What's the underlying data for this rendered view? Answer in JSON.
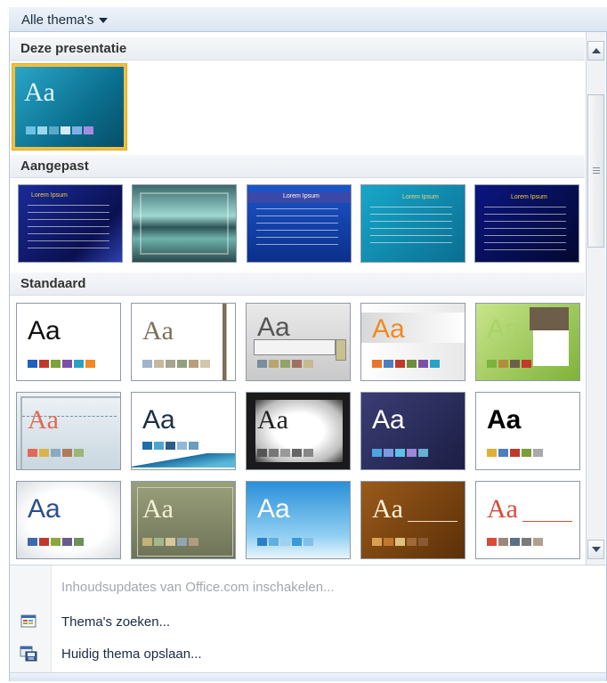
{
  "gallery": {
    "header_label": "Alle thema's",
    "sections": {
      "current": "Deze presentatie",
      "custom": "Aangepast",
      "standard": "Standaard"
    },
    "current_theme": {
      "sample": "Aa"
    },
    "custom_themes": [
      {
        "title": "Lorem Ipsum"
      },
      {
        "title": ""
      },
      {
        "title": "Lorem Ipsum"
      },
      {
        "title": "Lorem Ipsum"
      },
      {
        "title": "Lorem Ipsum"
      }
    ],
    "standard_themes": [
      {
        "sample": "Aa"
      },
      {
        "sample": "Aa"
      },
      {
        "sample": "Aa"
      },
      {
        "sample": "Aa"
      },
      {
        "sample": "Aa"
      },
      {
        "sample": "Aa"
      },
      {
        "sample": "Aa"
      },
      {
        "sample": "Aa"
      },
      {
        "sample": "Aa"
      },
      {
        "sample": "Aa"
      },
      {
        "sample": "Aa"
      },
      {
        "sample": "Aa"
      },
      {
        "sample": "Aa"
      },
      {
        "sample": "Aa"
      },
      {
        "sample": "Aa"
      }
    ]
  },
  "menu": {
    "enable_updates": "Inhoudsupdates van Office.com inschakelen...",
    "search_themes": "Thema's zoeken...",
    "save_theme": "Huidig thema opslaan..."
  },
  "icons": {
    "header_dropdown": "chevron-down-icon",
    "scroll_up": "arrow-up-icon",
    "scroll_down": "arrow-down-icon",
    "search_themes": "folder-theme-icon",
    "save_theme": "save-theme-icon"
  }
}
